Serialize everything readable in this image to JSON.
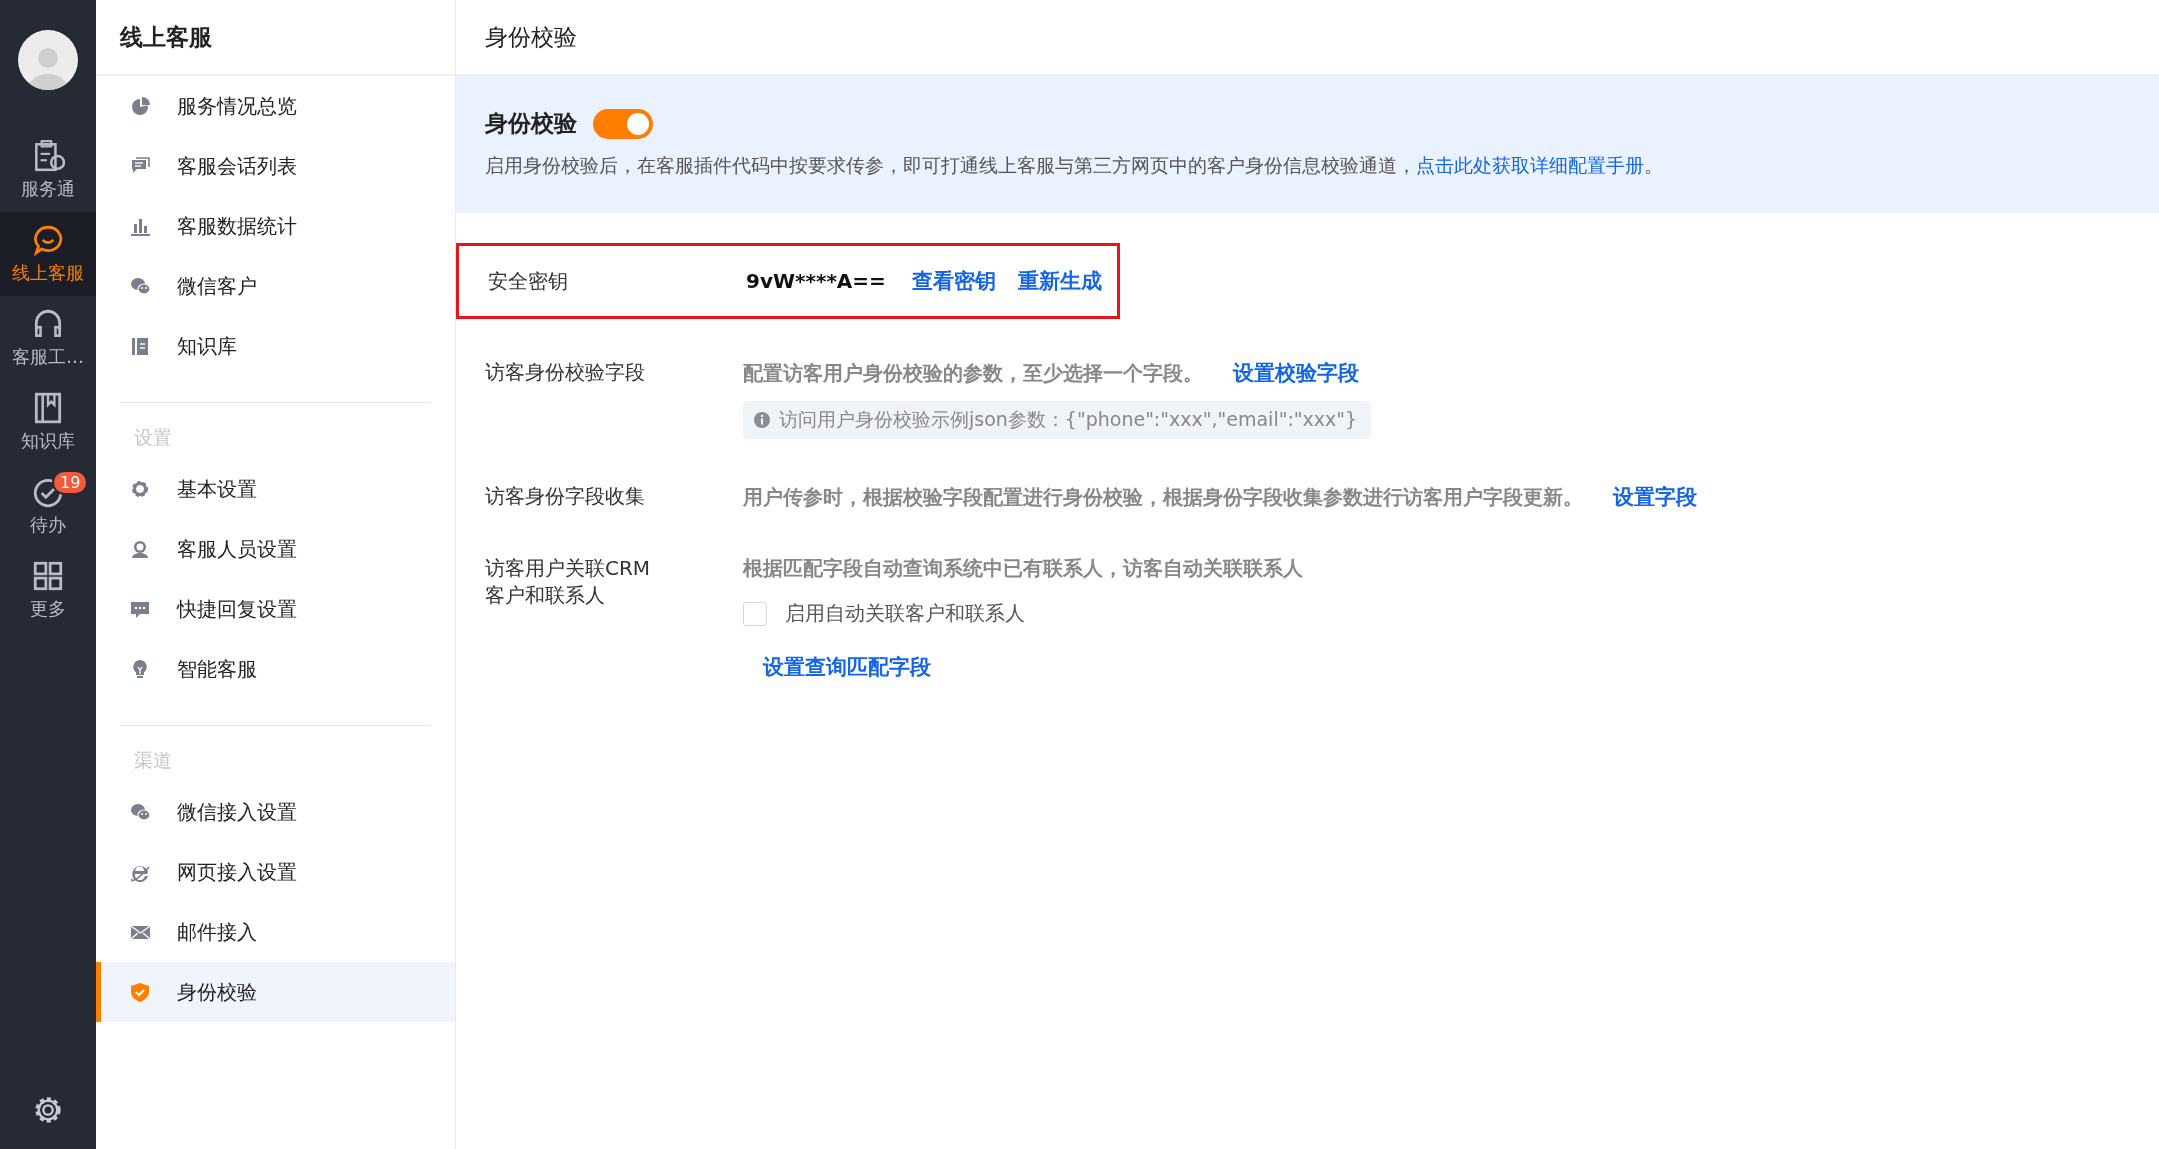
{
  "rail": {
    "items": [
      {
        "label": "服务通",
        "kind": "service",
        "selected": false
      },
      {
        "label": "线上客服",
        "kind": "chat",
        "selected": true
      },
      {
        "label": "客服工…",
        "kind": "headset",
        "selected": false
      },
      {
        "label": "知识库",
        "kind": "book",
        "selected": false
      },
      {
        "label": "待办",
        "kind": "todo",
        "selected": false,
        "badge": "19"
      },
      {
        "label": "更多",
        "kind": "grid",
        "selected": false
      }
    ]
  },
  "sidebar": {
    "title": "线上客服",
    "groups": [
      {
        "items": [
          {
            "label": "服务情况总览",
            "kind": "pie",
            "selected": false
          },
          {
            "label": "客服会话列表",
            "kind": "chat",
            "selected": false
          },
          {
            "label": "客服数据统计",
            "kind": "bars",
            "selected": false
          },
          {
            "label": "微信客户",
            "kind": "wechat",
            "selected": false
          },
          {
            "label": "知识库",
            "kind": "book",
            "selected": false
          }
        ]
      },
      {
        "heading": "设置",
        "items": [
          {
            "label": "基本设置",
            "kind": "gear",
            "selected": false
          },
          {
            "label": "客服人员设置",
            "kind": "agent",
            "selected": false
          },
          {
            "label": "快捷回复设置",
            "kind": "reply",
            "selected": false
          },
          {
            "label": "智能客服",
            "kind": "bulb",
            "selected": false
          }
        ]
      },
      {
        "heading": "渠道",
        "items": [
          {
            "label": "微信接入设置",
            "kind": "wechat",
            "selected": false
          },
          {
            "label": "网页接入设置",
            "kind": "browser",
            "selected": false
          },
          {
            "label": "邮件接入",
            "kind": "mail",
            "selected": false
          },
          {
            "label": "身份校验",
            "kind": "shield",
            "selected": true
          }
        ]
      }
    ]
  },
  "page_title": "身份校验",
  "banner": {
    "title": "身份校验",
    "toggle": {
      "on": true
    },
    "text": "启用身份校验后，在客服插件代码中按要求传参，即可打通线上客服与第三方网页中的客户身份信息校验通道，",
    "link": "点击此处获取详细配置手册",
    "text_after": "。"
  },
  "secret_key": {
    "label": "安全密钥",
    "value": "9vW****A==",
    "links": [
      "查看密钥",
      "重新生成"
    ],
    "highlighted": true
  },
  "rows": [
    {
      "label": "访客身份校验字段",
      "description": "配置访客用户身份校验的参数，至少选择一个字段。",
      "link": "设置校验字段",
      "hint": "访问用户身份校验示例json参数：{\"phone\":\"xxx\",\"email\":\"xxx\"}"
    },
    {
      "label": "访客身份字段收集",
      "description": "用户传参时，根据校验字段配置进行身份校验，根据身份字段收集参数进行访客用户字段更新。",
      "link": "设置字段"
    },
    {
      "label_lines": [
        "访客用户关联CRM",
        "客户和联系人"
      ],
      "description": "根据匹配字段自动查询系统中已有联系人，访客自动关联联系人",
      "checkbox": {
        "label": "启用自动关联客户和联系人",
        "checked": false
      },
      "bottom_link": "设置查询匹配字段"
    }
  ]
}
